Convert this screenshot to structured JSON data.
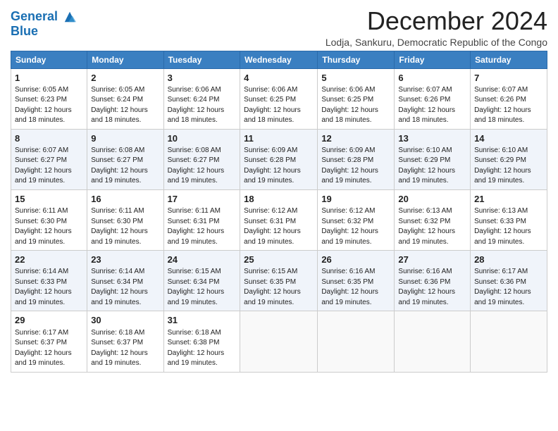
{
  "header": {
    "logo_line1": "General",
    "logo_line2": "Blue",
    "month_title": "December 2024",
    "subtitle": "Lodja, Sankuru, Democratic Republic of the Congo"
  },
  "days_of_week": [
    "Sunday",
    "Monday",
    "Tuesday",
    "Wednesday",
    "Thursday",
    "Friday",
    "Saturday"
  ],
  "weeks": [
    [
      {
        "day": 1,
        "sunrise": "6:05 AM",
        "sunset": "6:23 PM",
        "daylight": "12 hours and 18 minutes."
      },
      {
        "day": 2,
        "sunrise": "6:05 AM",
        "sunset": "6:24 PM",
        "daylight": "12 hours and 18 minutes."
      },
      {
        "day": 3,
        "sunrise": "6:06 AM",
        "sunset": "6:24 PM",
        "daylight": "12 hours and 18 minutes."
      },
      {
        "day": 4,
        "sunrise": "6:06 AM",
        "sunset": "6:25 PM",
        "daylight": "12 hours and 18 minutes."
      },
      {
        "day": 5,
        "sunrise": "6:06 AM",
        "sunset": "6:25 PM",
        "daylight": "12 hours and 18 minutes."
      },
      {
        "day": 6,
        "sunrise": "6:07 AM",
        "sunset": "6:26 PM",
        "daylight": "12 hours and 18 minutes."
      },
      {
        "day": 7,
        "sunrise": "6:07 AM",
        "sunset": "6:26 PM",
        "daylight": "12 hours and 18 minutes."
      }
    ],
    [
      {
        "day": 8,
        "sunrise": "6:07 AM",
        "sunset": "6:27 PM",
        "daylight": "12 hours and 19 minutes."
      },
      {
        "day": 9,
        "sunrise": "6:08 AM",
        "sunset": "6:27 PM",
        "daylight": "12 hours and 19 minutes."
      },
      {
        "day": 10,
        "sunrise": "6:08 AM",
        "sunset": "6:27 PM",
        "daylight": "12 hours and 19 minutes."
      },
      {
        "day": 11,
        "sunrise": "6:09 AM",
        "sunset": "6:28 PM",
        "daylight": "12 hours and 19 minutes."
      },
      {
        "day": 12,
        "sunrise": "6:09 AM",
        "sunset": "6:28 PM",
        "daylight": "12 hours and 19 minutes."
      },
      {
        "day": 13,
        "sunrise": "6:10 AM",
        "sunset": "6:29 PM",
        "daylight": "12 hours and 19 minutes."
      },
      {
        "day": 14,
        "sunrise": "6:10 AM",
        "sunset": "6:29 PM",
        "daylight": "12 hours and 19 minutes."
      }
    ],
    [
      {
        "day": 15,
        "sunrise": "6:11 AM",
        "sunset": "6:30 PM",
        "daylight": "12 hours and 19 minutes."
      },
      {
        "day": 16,
        "sunrise": "6:11 AM",
        "sunset": "6:30 PM",
        "daylight": "12 hours and 19 minutes."
      },
      {
        "day": 17,
        "sunrise": "6:11 AM",
        "sunset": "6:31 PM",
        "daylight": "12 hours and 19 minutes."
      },
      {
        "day": 18,
        "sunrise": "6:12 AM",
        "sunset": "6:31 PM",
        "daylight": "12 hours and 19 minutes."
      },
      {
        "day": 19,
        "sunrise": "6:12 AM",
        "sunset": "6:32 PM",
        "daylight": "12 hours and 19 minutes."
      },
      {
        "day": 20,
        "sunrise": "6:13 AM",
        "sunset": "6:32 PM",
        "daylight": "12 hours and 19 minutes."
      },
      {
        "day": 21,
        "sunrise": "6:13 AM",
        "sunset": "6:33 PM",
        "daylight": "12 hours and 19 minutes."
      }
    ],
    [
      {
        "day": 22,
        "sunrise": "6:14 AM",
        "sunset": "6:33 PM",
        "daylight": "12 hours and 19 minutes."
      },
      {
        "day": 23,
        "sunrise": "6:14 AM",
        "sunset": "6:34 PM",
        "daylight": "12 hours and 19 minutes."
      },
      {
        "day": 24,
        "sunrise": "6:15 AM",
        "sunset": "6:34 PM",
        "daylight": "12 hours and 19 minutes."
      },
      {
        "day": 25,
        "sunrise": "6:15 AM",
        "sunset": "6:35 PM",
        "daylight": "12 hours and 19 minutes."
      },
      {
        "day": 26,
        "sunrise": "6:16 AM",
        "sunset": "6:35 PM",
        "daylight": "12 hours and 19 minutes."
      },
      {
        "day": 27,
        "sunrise": "6:16 AM",
        "sunset": "6:36 PM",
        "daylight": "12 hours and 19 minutes."
      },
      {
        "day": 28,
        "sunrise": "6:17 AM",
        "sunset": "6:36 PM",
        "daylight": "12 hours and 19 minutes."
      }
    ],
    [
      {
        "day": 29,
        "sunrise": "6:17 AM",
        "sunset": "6:37 PM",
        "daylight": "12 hours and 19 minutes."
      },
      {
        "day": 30,
        "sunrise": "6:18 AM",
        "sunset": "6:37 PM",
        "daylight": "12 hours and 19 minutes."
      },
      {
        "day": 31,
        "sunrise": "6:18 AM",
        "sunset": "6:38 PM",
        "daylight": "12 hours and 19 minutes."
      },
      null,
      null,
      null,
      null
    ]
  ]
}
